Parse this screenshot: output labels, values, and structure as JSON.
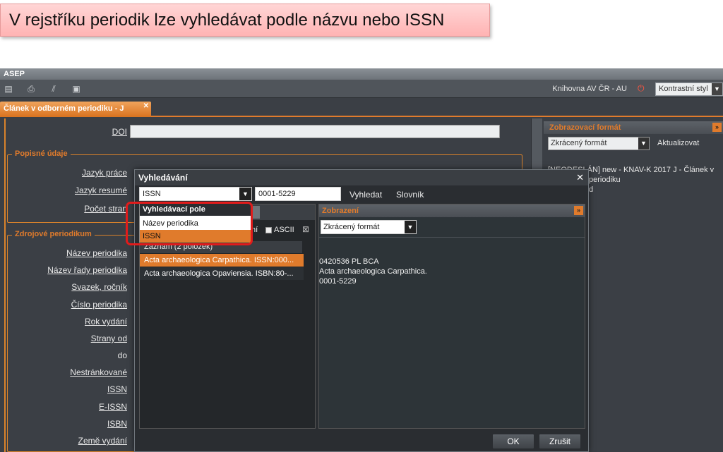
{
  "banner": {
    "text": "V rejstříku periodik lze vyhledávat podle názvu nebo ISSN"
  },
  "app": {
    "title": "ASEP",
    "toolbar": {
      "icons": [
        "list-icon",
        "print-icon",
        "stripes-icon",
        "save-icon"
      ],
      "organization": "Knihovna AV ČR - AU",
      "style_select": "Kontrastní styl"
    },
    "doc_tab": {
      "label": "Článek v odborném periodiku - J"
    },
    "form": {
      "doi_label": "DOI",
      "section_popisne": "Popisné údaje",
      "jazyk_prace": "Jazyk práce",
      "jazyk_resume": "Jazyk resumé",
      "pocet_stran": "Počet stran",
      "section_zdrojove": "Zdrojové periodikum",
      "fields": [
        "Název periodika",
        "Název řady periodika",
        "Svazek, ročník",
        "Číslo periodika",
        "Rok vydání",
        "Strany od",
        "do",
        "Nestránkované",
        "ISSN",
        "E-ISSN",
        "ISBN",
        "Země vydání"
      ]
    },
    "right_panel": {
      "header": "Zobrazovací formát",
      "format_select": "Zkrácený formát",
      "update": "Aktualizovat",
      "text_line1": "[NEODESLÁN] new - KNAV-K 2017 J - Článek v",
      "text_line2": "periodiku",
      "text_line3": "d"
    }
  },
  "dialog": {
    "title": "Vyhledávání",
    "field_select": "ISSN",
    "search_value": "0001-5229",
    "search_button": "Vyhledat",
    "dictionary_button": "Slovník",
    "filter_text": "ní",
    "ascii_label": "ASCII",
    "record_count": "Záznam (2 položek)",
    "results": [
      "Acta archaeologica Carpathica. ISSN:000...",
      "Acta archaeologica Opaviensia. ISBN:80-..."
    ],
    "display": {
      "header": "Zobrazení",
      "format_select": "Zkrácený formát",
      "lines": [
        "0420536 PL BCA",
        "Acta archaeologica Carpathica.",
        "0001-5229"
      ]
    },
    "ok_button": "OK",
    "cancel_button": "Zrušit",
    "popup": {
      "header": "Vyhledávací pole",
      "items": [
        "Název periodika",
        "ISSN"
      ]
    }
  },
  "colors": {
    "accent": "#e07b2c",
    "highlight_box": "#e21b1b"
  }
}
